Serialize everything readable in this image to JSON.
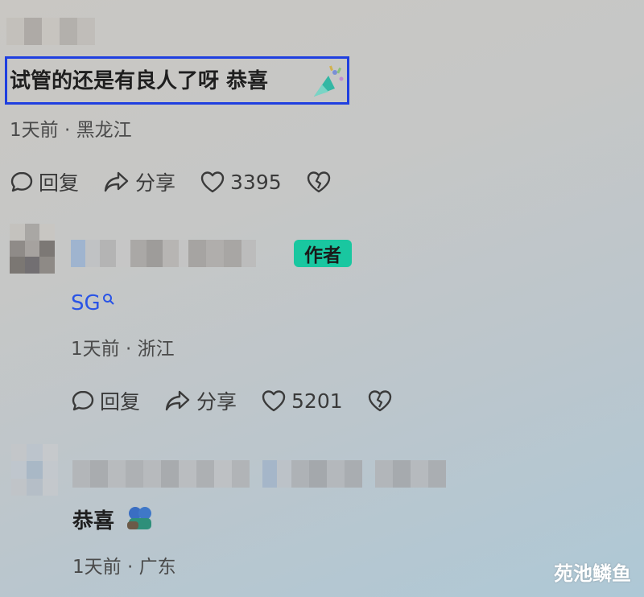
{
  "comments": [
    {
      "text": "试管的还是有良人了呀 恭喜",
      "emoji_icon": "party-popper-icon",
      "meta": "1天前 · 黑龙江",
      "actions": {
        "reply": "回复",
        "share": "分享",
        "likes": "3395"
      }
    },
    {
      "badge": "作者",
      "link_text": "SG",
      "meta": "1天前 · 浙江",
      "actions": {
        "reply": "回复",
        "share": "分享",
        "likes": "5201"
      }
    },
    {
      "text": "恭喜",
      "emoji_icon": "hug-icon",
      "meta": "1天前 · 广东"
    }
  ],
  "watermark": "苑池鳞鱼",
  "colors": {
    "highlight_border": "#1f3fe0",
    "author_badge": "#19c7a0",
    "link": "#2a54e6"
  }
}
